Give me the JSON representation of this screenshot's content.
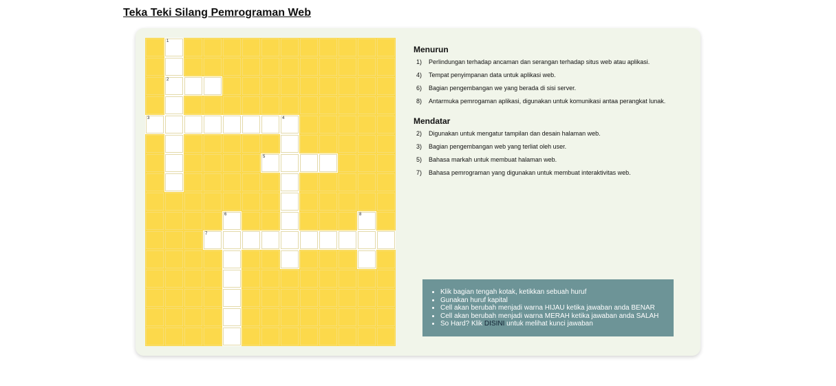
{
  "page": {
    "title": "Teka Teki Silang Pemrograman Web"
  },
  "grid": {
    "open_cells": [
      [
        0,
        1
      ],
      [
        1,
        1
      ],
      [
        2,
        1
      ],
      [
        2,
        2
      ],
      [
        2,
        3
      ],
      [
        3,
        1
      ],
      [
        4,
        0
      ],
      [
        4,
        1
      ],
      [
        4,
        2
      ],
      [
        4,
        3
      ],
      [
        4,
        4
      ],
      [
        4,
        5
      ],
      [
        4,
        6
      ],
      [
        4,
        7
      ],
      [
        5,
        1
      ],
      [
        5,
        7
      ],
      [
        6,
        1
      ],
      [
        6,
        6
      ],
      [
        6,
        7
      ],
      [
        6,
        8
      ],
      [
        6,
        9
      ],
      [
        7,
        1
      ],
      [
        7,
        7
      ],
      [
        8,
        7
      ],
      [
        9,
        4
      ],
      [
        9,
        7
      ],
      [
        9,
        11
      ],
      [
        10,
        3
      ],
      [
        10,
        4
      ],
      [
        10,
        5
      ],
      [
        10,
        6
      ],
      [
        10,
        7
      ],
      [
        10,
        8
      ],
      [
        10,
        9
      ],
      [
        10,
        10
      ],
      [
        10,
        11
      ],
      [
        10,
        12
      ],
      [
        11,
        4
      ],
      [
        11,
        7
      ],
      [
        11,
        11
      ],
      [
        12,
        4
      ],
      [
        13,
        4
      ],
      [
        14,
        4
      ],
      [
        15,
        4
      ]
    ],
    "numbers": [
      {
        "row": 0,
        "col": 1,
        "n": "1"
      },
      {
        "row": 2,
        "col": 1,
        "n": "2"
      },
      {
        "row": 4,
        "col": 0,
        "n": "3"
      },
      {
        "row": 4,
        "col": 7,
        "n": "4"
      },
      {
        "row": 6,
        "col": 6,
        "n": "5"
      },
      {
        "row": 9,
        "col": 4,
        "n": "6"
      },
      {
        "row": 9,
        "col": 11,
        "n": "8"
      },
      {
        "row": 10,
        "col": 3,
        "n": "7"
      }
    ]
  },
  "clues": {
    "down_title": "Menurun",
    "down": [
      {
        "num": "1)",
        "text": "Perlindungan terhadap ancaman dan serangan terhadap situs web atau aplikasi."
      },
      {
        "num": "4)",
        "text": "Tempat penyimpanan data untuk aplikasi web."
      },
      {
        "num": "6)",
        "text": "Bagian pengembangan we yang berada di sisi server."
      },
      {
        "num": "8)",
        "text": "Antarmuka pemrogaman aplikasi, digunakan untuk komunikasi antaa perangkat lunak."
      }
    ],
    "across_title": "Mendatar",
    "across": [
      {
        "num": "2)",
        "text": "Digunakan untuk mengatur tampilan dan desain halaman web."
      },
      {
        "num": "3)",
        "text": "Bagian pengembangan web yang terliat oleh user."
      },
      {
        "num": "5)",
        "text": "Bahasa markah untuk membuat halaman web."
      },
      {
        "num": "7)",
        "text": "Bahasa pemrograman yang digunakan untuk membuat interaktivitas web."
      }
    ]
  },
  "help": {
    "items": [
      "Klik bagian tengah kotak, ketikkan sebuah huruf",
      "Gunakan huruf kapital",
      "Cell akan berubah menjadi warna HIJAU ketika jawaban anda BENAR",
      "Cell akan berubah menjadi warna MERAH ketika jawaban anda SALAH"
    ],
    "last_prefix": "So Hard? Klik ",
    "last_link": "DISINI",
    "last_suffix": " untuk melihat kunci jawaban"
  },
  "colors": {
    "blocked_cell": "#fcd94b",
    "open_cell": "#ffffff",
    "card_bg": "#f1f5ea",
    "help_bg": "#6d9497"
  }
}
